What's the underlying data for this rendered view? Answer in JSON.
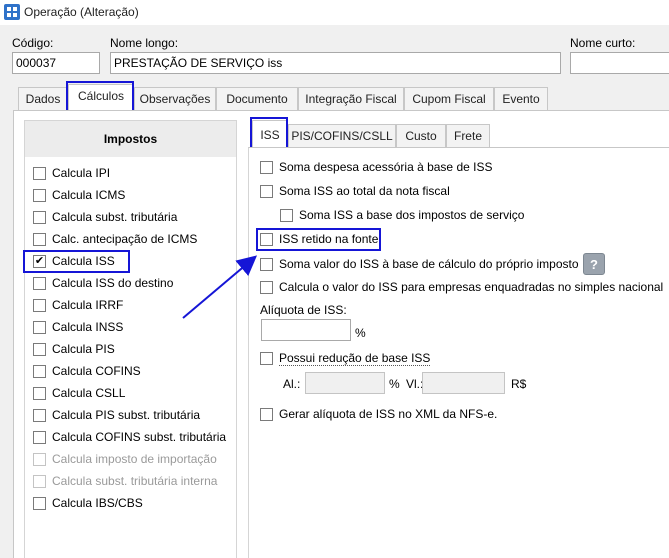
{
  "window": {
    "title": "Operação (Alteração)"
  },
  "header": {
    "codigo_label": "Código:",
    "codigo_value": "000037",
    "nome_longo_label": "Nome longo:",
    "nome_longo_value": "PRESTAÇÃO DE SERVIÇO iss",
    "nome_curto_label": "Nome curto:",
    "nome_curto_value": ""
  },
  "main_tabs": [
    "Dados",
    "Cálculos",
    "Observações",
    "Documento",
    "Integração Fiscal",
    "Cupom Fiscal",
    "Evento"
  ],
  "main_tabs_active": "Cálculos",
  "impostos": {
    "title": "Impostos",
    "items": [
      {
        "label": "Calcula IPI",
        "checked": false,
        "enabled": true
      },
      {
        "label": "Calcula ICMS",
        "checked": false,
        "enabled": true
      },
      {
        "label": "Calcula subst. tributária",
        "checked": false,
        "enabled": true
      },
      {
        "label": "Calc. antecipação de ICMS",
        "checked": false,
        "enabled": true
      },
      {
        "label": "Calcula ISS",
        "checked": true,
        "enabled": true
      },
      {
        "label": "Calcula ISS do destino",
        "checked": false,
        "enabled": true
      },
      {
        "label": "Calcula IRRF",
        "checked": false,
        "enabled": true
      },
      {
        "label": "Calcula INSS",
        "checked": false,
        "enabled": true
      },
      {
        "label": "Calcula PIS",
        "checked": false,
        "enabled": true
      },
      {
        "label": "Calcula COFINS",
        "checked": false,
        "enabled": true
      },
      {
        "label": "Calcula CSLL",
        "checked": false,
        "enabled": true
      },
      {
        "label": "Calcula PIS subst. tributária",
        "checked": false,
        "enabled": true
      },
      {
        "label": "Calcula COFINS subst. tributária",
        "checked": false,
        "enabled": true
      },
      {
        "label": "Calcula imposto de importação",
        "checked": false,
        "enabled": false
      },
      {
        "label": "Calcula subst. tributária interna",
        "checked": false,
        "enabled": false
      },
      {
        "label": "Calcula IBS/CBS",
        "checked": false,
        "enabled": true
      }
    ]
  },
  "sub_tabs": [
    "ISS",
    "PIS/COFINS/CSLL",
    "Custo",
    "Frete"
  ],
  "sub_tabs_active": "ISS",
  "iss": {
    "soma_despesa": "Soma despesa acessória à base de ISS",
    "soma_iss_total": "Soma ISS ao total da nota fiscal",
    "soma_iss_base": "Soma ISS a base dos impostos de serviço",
    "iss_retido": "ISS retido na fonte",
    "soma_valor_iss": "Soma valor do ISS à base de cálculo do próprio imposto",
    "help_icon": "?",
    "calcula_simples": "Calcula o valor do ISS para empresas enquadradas no simples nacional",
    "aliquota_label": "Alíquota de ISS:",
    "aliquota_value": "",
    "percent_sign": "%",
    "reducao_label": "Possui redução de base ISS",
    "al_label": "Al.:",
    "al_percent": "%",
    "vl_label": "Vl.:",
    "vl_currency": "R$",
    "gerar_aliquota": "Gerar alíquota de ISS no XML da NFS-e."
  },
  "colors": {
    "highlight": "#1515d6",
    "arrow": "#1515d6"
  }
}
